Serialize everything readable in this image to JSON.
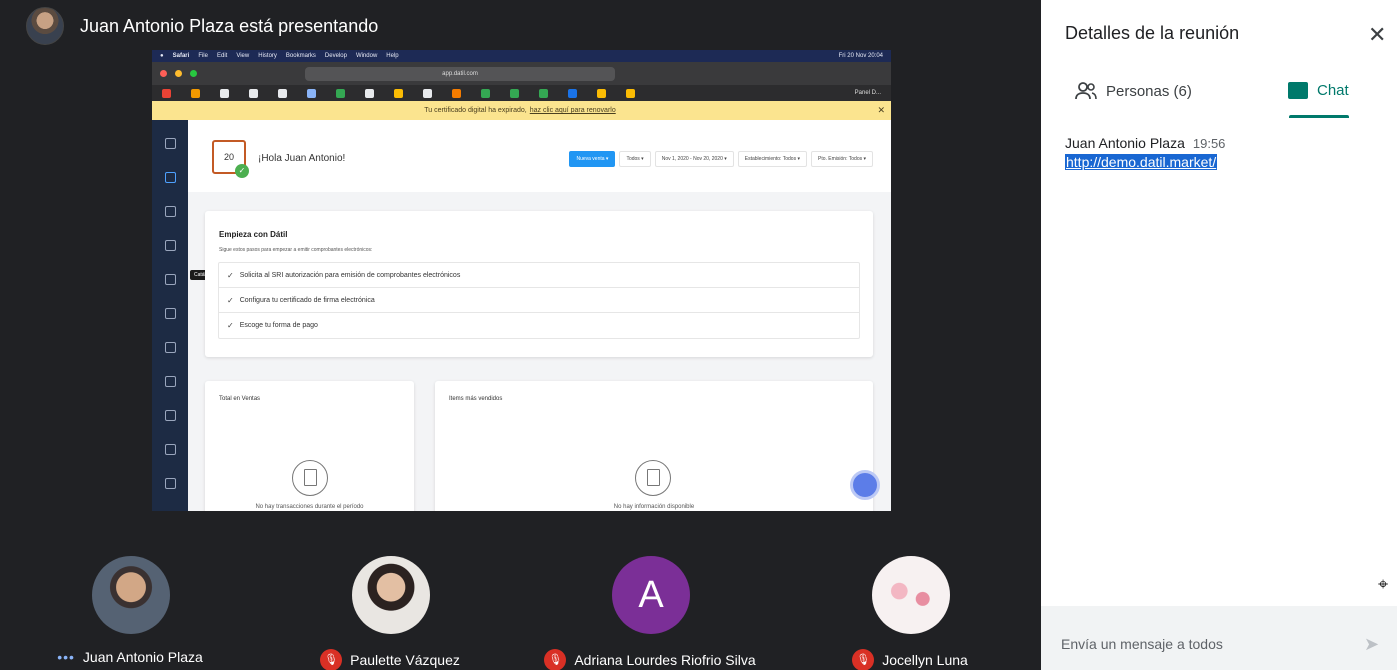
{
  "presenter_bar": {
    "title": "Juan Antonio Plaza está presentando"
  },
  "shared_screen": {
    "menubar": {
      "app": "Safari",
      "items": [
        "File",
        "Edit",
        "View",
        "History",
        "Bookmarks",
        "Develop",
        "Window",
        "Help"
      ],
      "clock": "Fri 20 Nov 20:04"
    },
    "url": "app.datil.com",
    "bookmark_last": "Panel D...",
    "banner": {
      "text": "Tu certificado digital ha expirado,",
      "link": "haz clic aquí para renovarlo"
    },
    "tooltip": "Catálogo",
    "header": {
      "calendar_day": "20",
      "greeting": "¡Hola Juan Antonio!",
      "buttons": [
        "Nueva venta ▾",
        "Todos ▾",
        "Nov 1, 2020 - Nov 20, 2020 ▾",
        "Establecimiento: Todos ▾",
        "Pto. Emisión: Todos ▾"
      ]
    },
    "onboarding": {
      "title": "Empieza con Dátil",
      "subtitle": "Sigue estos pasos para empezar a emitir comprobantes electrónicos:",
      "steps": [
        "Solicita al SRI autorización para emisión de comprobantes electrónicos",
        "Configura tu certificado de firma electrónica",
        "Escoge tu forma de pago"
      ]
    },
    "sales_card": {
      "title": "Total en Ventas",
      "empty": "No hay transacciones durante el período"
    },
    "items_card": {
      "title": "Items más vendidos",
      "empty": "No hay información disponible"
    }
  },
  "participants": [
    {
      "name": "Juan Antonio Plaza",
      "muted": false,
      "avatar": "photo-man"
    },
    {
      "name": "Paulette Vázquez",
      "muted": true,
      "avatar": "photo-woman"
    },
    {
      "name": "Adriana Lourdes Riofrio Silva",
      "muted": true,
      "avatar_letter": "A"
    },
    {
      "name": "Jocellyn Luna",
      "muted": true,
      "avatar": "flowers"
    }
  ],
  "panel": {
    "title": "Detalles de la reunión",
    "tab_people": "Personas (6)",
    "tab_chat": "Chat",
    "message": {
      "sender": "Juan Antonio Plaza",
      "time": "19:56",
      "link": "http://demo.datil.market/"
    },
    "input_placeholder": "Envía un mensaje a todos"
  },
  "colors": {
    "accent": "#00796b",
    "mic_off": "#d93025",
    "banner": "#fbe48f",
    "primary_btn": "#2196f3"
  }
}
